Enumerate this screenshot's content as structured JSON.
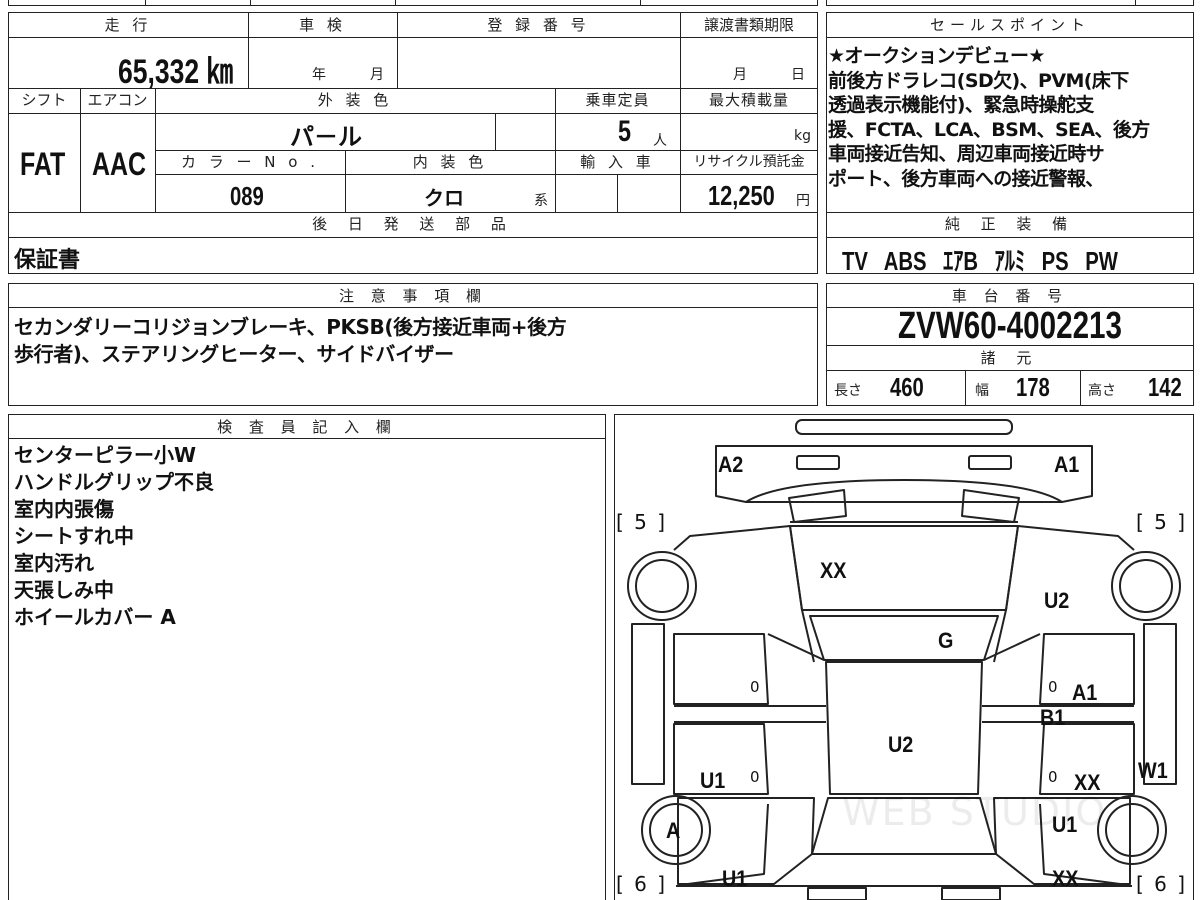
{
  "top_strip": [
    "",
    "",
    "",
    "",
    ""
  ],
  "headers": {
    "mileage": "走 行",
    "inspection": "車 検",
    "registration": "登 録 番 号",
    "transfer_deadline": "譲渡書類期限",
    "sales_point": "セールスポイント",
    "shift": "シフト",
    "aircon": "エアコン",
    "exterior_color": "外 装 色",
    "capacity": "乗車定員",
    "max_load": "最大積載量",
    "color_no": "カ ラ ー N o .",
    "interior_color": "内 装 色",
    "import": "輸 入 車",
    "recycle": "リサイクル預託金",
    "later_parts": "後 日 発 送 部 品",
    "genuine_equipment": "純 正 装 備",
    "notes": "注 意 事 項 欄",
    "chassis_no": "車 台 番 号",
    "specs": "諸 元",
    "inspector": "検 査 員 記 入 欄"
  },
  "vehicle": {
    "mileage": "65,332 ㎞",
    "inspection_year_unit": "年",
    "inspection_month_unit": "月",
    "transfer_month_unit": "月",
    "transfer_day_unit": "日",
    "shift": "FAT",
    "aircon": "AAC",
    "exterior_color": "パ－ル",
    "capacity": "5",
    "capacity_unit": "人",
    "max_load_unit": "kg",
    "color_no": "089",
    "interior_color": "クロ",
    "interior_suffix": "系",
    "recycle_fee": "12,250",
    "recycle_unit": "円",
    "later_parts": "保証書",
    "chassis_no": "ZVW60-4002213"
  },
  "sales_point_lines": [
    "★オークションデビュー★",
    "前後方ドラレコ(SD欠)、PVM(床下",
    "透過表示機能付)、緊急時操舵支",
    "援、FCTA、LCA、BSM、SEA、後方",
    "車両接近告知、周辺車両接近時サ",
    "ポート、後方車両への接近警報、"
  ],
  "equipment": [
    "TV",
    "ABS",
    "ｴｱB",
    "ｱﾙﾐ",
    "PS",
    "PW"
  ],
  "notes_lines": [
    "セカンダリーコリジョンブレーキ、PKSB(後方接近車両+後方",
    "歩行者)、ステアリングヒーター、サイドバイザー"
  ],
  "specs": {
    "length_label": "長さ",
    "length": "460",
    "width_label": "幅",
    "width": "178",
    "height_label": "高さ",
    "height": "142"
  },
  "inspector_lines": [
    "センターピラー小W",
    "ハンドルグリップ不良",
    "室内内張傷",
    "シートすれ中",
    "室内汚れ",
    "天張しみ中",
    "ホイールカバー A"
  ],
  "diagram": {
    "tire_fl": "[ 5 ]",
    "tire_fr": "[ 5 ]",
    "tire_rl": "[ 6 ]",
    "tire_rr": "[ 6 ]",
    "marks": {
      "bumper_left": "A2",
      "bumper_right": "A1",
      "hood": "XX",
      "fender_right": "U2",
      "windshield": "G",
      "roof": "U2",
      "door_right_front": "A1",
      "pillar_right": "B1",
      "door_left_rear": "U1",
      "door_right_rear": "XX",
      "side_right": "W1",
      "wheel_left_rear": "A",
      "quarter_right": "U1",
      "quarter_left": "U1",
      "trunk_right": "XX"
    },
    "zero_marks": [
      "0",
      "0",
      "0",
      "0"
    ]
  },
  "watermark": "WEB STUDIO"
}
